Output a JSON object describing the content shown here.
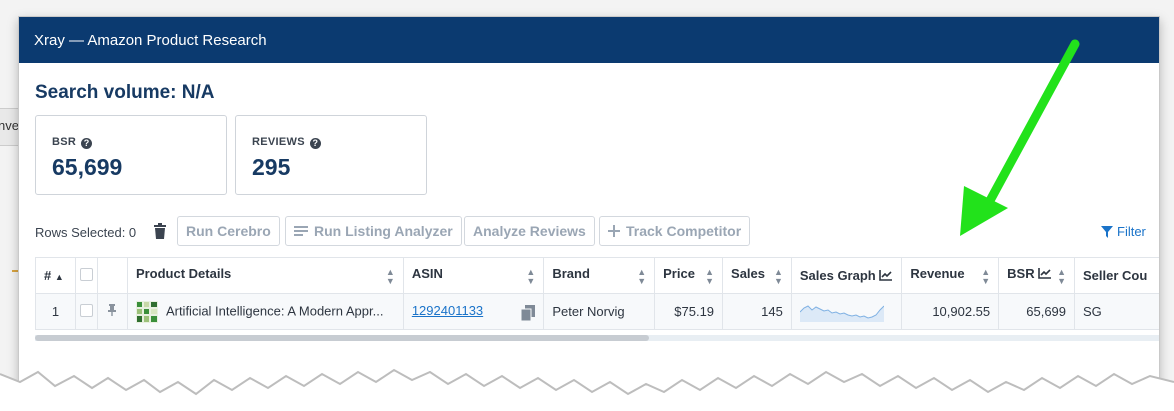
{
  "background": {
    "partial_text": "nve"
  },
  "window": {
    "title": "Xray — Amazon Product Research"
  },
  "summary": {
    "search_volume": "Search volume: N/A",
    "bsr": {
      "label": "BSR",
      "value": "65,699"
    },
    "reviews": {
      "label": "REVIEWS",
      "value": "295"
    }
  },
  "toolbar": {
    "rows_selected": "Rows Selected: 0",
    "buttons": [
      "Run Cerebro",
      "Run Listing Analyzer",
      "Analyze Reviews",
      "Track Competitor"
    ],
    "filter": "Filter"
  },
  "table": {
    "columns": [
      "#",
      "",
      "",
      "Product Details",
      "ASIN",
      "Brand",
      "Price",
      "Sales",
      "Sales Graph",
      "Revenue",
      "BSR",
      "Seller Cou"
    ],
    "rows": [
      {
        "index": "1",
        "product": "Artificial Intelligence: A Modern Appr...",
        "asin": "1292401133",
        "brand": "Peter Norvig",
        "price": "$75.19",
        "sales": "145",
        "revenue": "10,902.55",
        "bsr": "65,699",
        "seller_country": "SG"
      }
    ]
  },
  "colors": {
    "header_bg": "#0b3a70",
    "accent_text": "#173a63",
    "link": "#1a73c9",
    "arrow": "#22e21b"
  },
  "icons": [
    "help-icon",
    "trash-icon",
    "list-icon",
    "plus-icon",
    "filter-icon",
    "pin-icon",
    "copy-icon",
    "chart-icon",
    "sort-icon"
  ]
}
